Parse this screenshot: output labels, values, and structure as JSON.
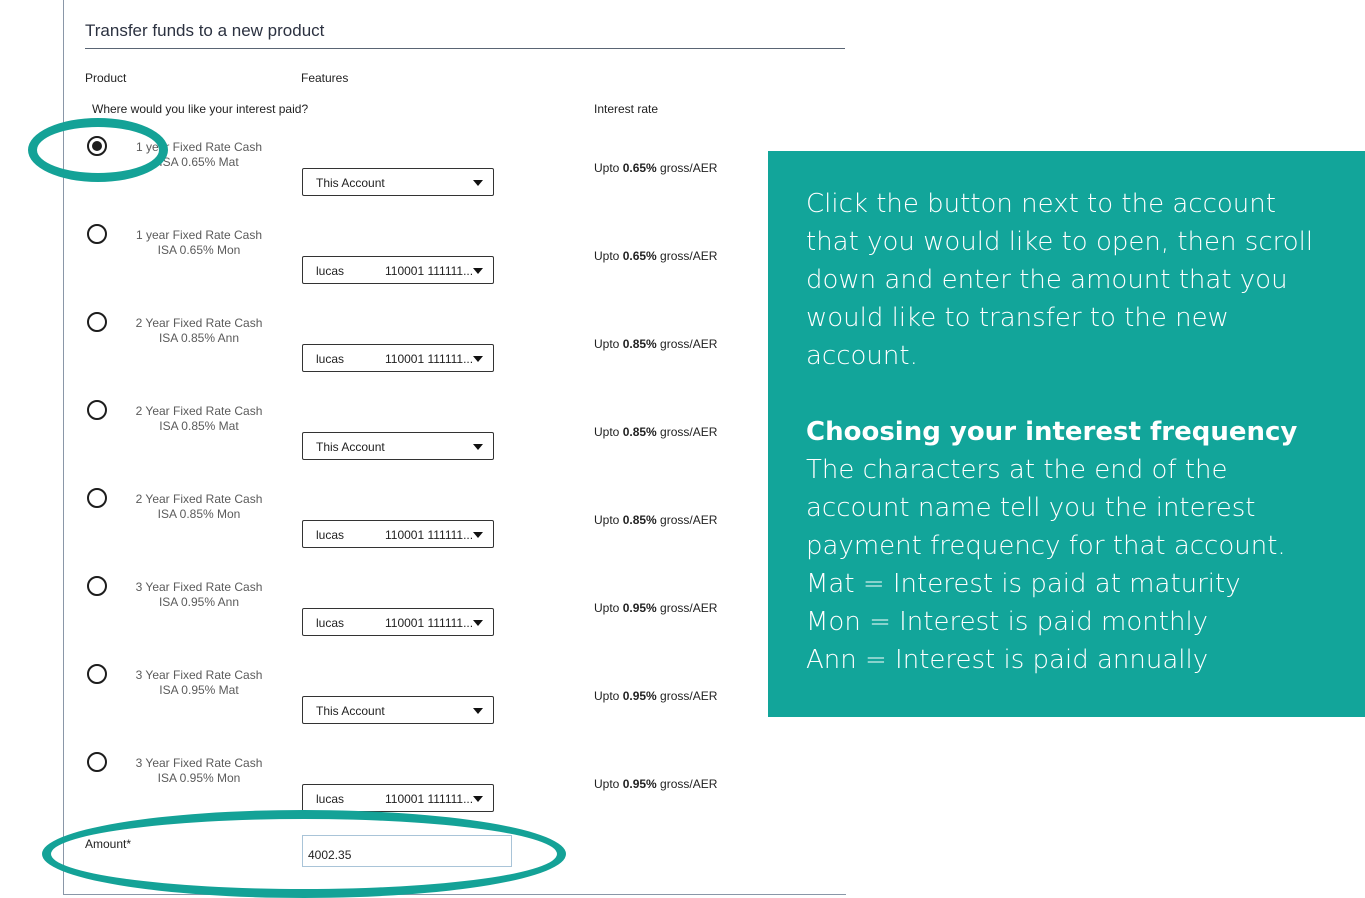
{
  "page": {
    "title": "Transfer funds to a new product"
  },
  "columns": {
    "product": "Product",
    "features": "Features",
    "interest_question": "Where would you like your interest paid?",
    "interest_rate": "Interest rate"
  },
  "products": [
    {
      "line1": "1 year Fixed Rate Cash",
      "line2": "ISA 0.65% Mat",
      "selected": true,
      "paid_to": "This Account",
      "paid_to_number": "",
      "rate_prefix": "Upto ",
      "rate_value": "0.65%",
      "rate_suffix": " gross/AER"
    },
    {
      "line1": "1 year Fixed Rate Cash",
      "line2": "ISA 0.65% Mon",
      "selected": false,
      "paid_to": "lucas",
      "paid_to_number": "110001 111111...",
      "rate_prefix": "Upto ",
      "rate_value": "0.65%",
      "rate_suffix": " gross/AER"
    },
    {
      "line1": "2 Year Fixed Rate Cash",
      "line2": "ISA 0.85% Ann",
      "selected": false,
      "paid_to": "lucas",
      "paid_to_number": "110001 111111...",
      "rate_prefix": "Upto ",
      "rate_value": "0.85%",
      "rate_suffix": " gross/AER"
    },
    {
      "line1": "2 Year Fixed Rate Cash",
      "line2": "ISA 0.85% Mat",
      "selected": false,
      "paid_to": "This Account",
      "paid_to_number": "",
      "rate_prefix": "Upto ",
      "rate_value": "0.85%",
      "rate_suffix": " gross/AER"
    },
    {
      "line1": "2 Year Fixed Rate Cash",
      "line2": "ISA 0.85% Mon",
      "selected": false,
      "paid_to": "lucas",
      "paid_to_number": "110001 111111...",
      "rate_prefix": "Upto ",
      "rate_value": "0.85%",
      "rate_suffix": " gross/AER"
    },
    {
      "line1": "3 Year Fixed Rate Cash",
      "line2": "ISA 0.95% Ann",
      "selected": false,
      "paid_to": "lucas",
      "paid_to_number": "110001 111111...",
      "rate_prefix": "Upto ",
      "rate_value": "0.95%",
      "rate_suffix": " gross/AER"
    },
    {
      "line1": "3 Year Fixed Rate Cash",
      "line2": "ISA 0.95% Mat",
      "selected": false,
      "paid_to": "This Account",
      "paid_to_number": "",
      "rate_prefix": "Upto ",
      "rate_value": "0.95%",
      "rate_suffix": " gross/AER"
    },
    {
      "line1": "3 Year Fixed Rate Cash",
      "line2": "ISA 0.95% Mon",
      "selected": false,
      "paid_to": "lucas",
      "paid_to_number": "110001 111111...",
      "rate_prefix": "Upto ",
      "rate_value": "0.95%",
      "rate_suffix": " gross/AER"
    }
  ],
  "amount": {
    "label": "Amount*",
    "value": "4002.35"
  },
  "callout": {
    "intro": "Click the button next to the account that you would like to open, then scroll down and enter the amount that you would like to transfer to the new account.",
    "heading": "Choosing your interest frequency",
    "body": "The characters at the end of the account name tell you the interest payment frequency for that account.",
    "mat": "Mat = Interest is paid at maturity",
    "mon": "Mon = Interest is paid monthly",
    "ann": "Ann = Interest is paid annually"
  },
  "colors": {
    "accent": "#12a59a",
    "ring": "#14a297"
  }
}
